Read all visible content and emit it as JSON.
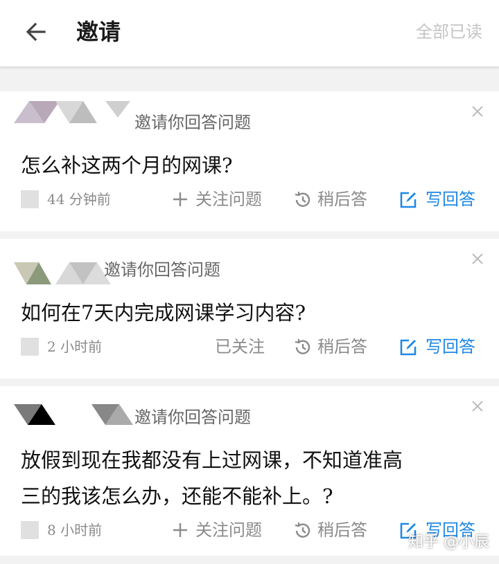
{
  "header": {
    "title": "邀请",
    "mark_all_read": "全部已读"
  },
  "invites": [
    {
      "invite_text": "邀请你回答问题",
      "question": "怎么补这两个月的网课?",
      "time": "44 分钟前",
      "follow_label": "关注问题",
      "later_label": "稍后答",
      "answer_label": "写回答"
    },
    {
      "invite_text": "邀请你回答问题",
      "question": "如何在7天内完成网课学习内容?",
      "time": "2 小时前",
      "follow_label": "已关注",
      "later_label": "稍后答",
      "answer_label": "写回答"
    },
    {
      "invite_text": "邀请你回答问题",
      "question_line1": "放假到现在我都没有上过网课，不知道准高",
      "question_line2": "三的我该怎么办，还能不能补上。?",
      "time": "8 小时前",
      "follow_label": "关注问题",
      "later_label": "稍后答",
      "answer_label": "写回答"
    }
  ],
  "watermark": "知乎 @小辰",
  "colors": {
    "accent": "#1e88e5",
    "muted": "#8a8a8a",
    "background": "#f2f2f2"
  }
}
